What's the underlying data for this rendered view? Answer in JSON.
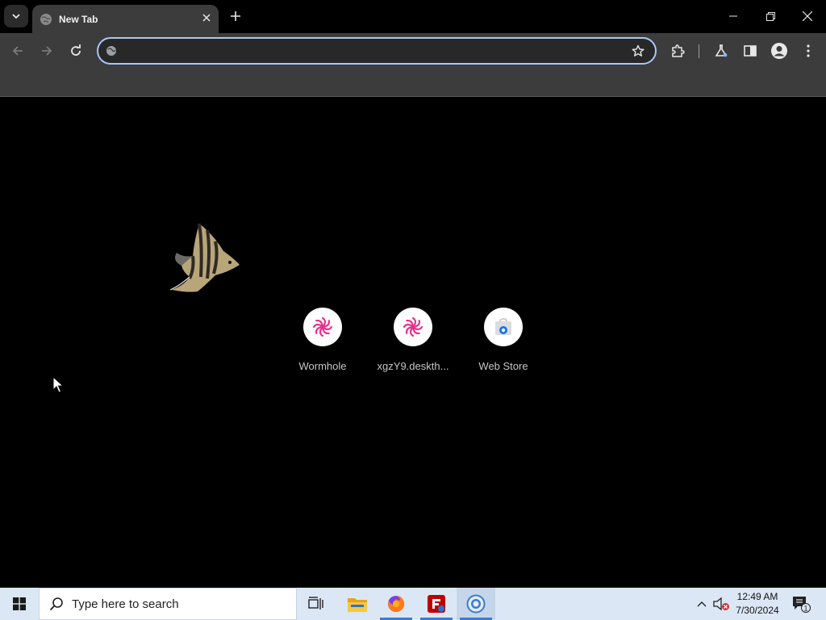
{
  "browser": {
    "tab_title": "New Tab",
    "omnibox_value": "",
    "omnibox_placeholder": "",
    "accent_color": "#a8c7fa"
  },
  "shortcuts": [
    {
      "label": "Wormhole",
      "icon": "wormhole-icon",
      "color": "#e8308a"
    },
    {
      "label": "xgzY9.deskth...",
      "icon": "wormhole-icon",
      "color": "#e8308a"
    },
    {
      "label": "Web Store",
      "icon": "web-store-icon",
      "color": "#1a73e8"
    }
  ],
  "taskbar": {
    "search_placeholder": "Type here to search",
    "apps": [
      "task-view-icon",
      "file-explorer-icon",
      "firefox-icon",
      "filezilla-icon",
      "chrome-icon"
    ],
    "time": "12:49 AM",
    "date": "7/30/2024",
    "notification_count": "1"
  }
}
